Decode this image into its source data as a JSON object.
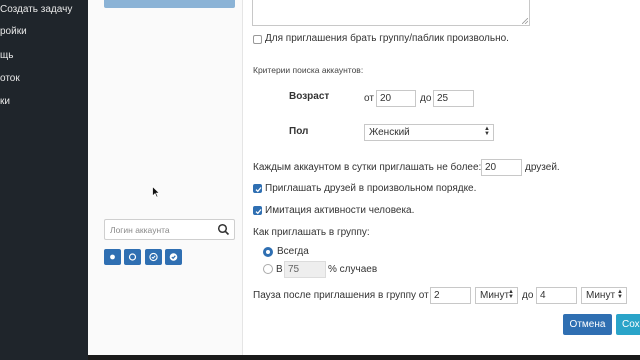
{
  "nav": {
    "items": [
      {
        "label": "Создать задачу"
      },
      {
        "label": "ройки"
      },
      {
        "label": "щь"
      },
      {
        "label": "оток"
      },
      {
        "label": "ки"
      }
    ]
  },
  "sidebar": {
    "login_placeholder": "Логин аккаунта"
  },
  "form": {
    "random_group_label": "Для приглашения брать группу/паблик произвольно.",
    "criteria_title": "Критерии поиска аккаунтов:",
    "age_label": "Возраст",
    "age_from_label": "от",
    "age_from": "20",
    "age_to_label": "до",
    "age_to": "25",
    "gender_label": "Пол",
    "gender_value": "Женский",
    "daily_label": "Каждым аккаунтом в сутки приглашать не более:",
    "daily_value": "20",
    "daily_suffix": "друзей.",
    "random_order_label": "Приглашать друзей в произвольном порядке.",
    "human_label": "Имитация активности человека.",
    "how_label": "Как приглашать в группу:",
    "always_label": "Всегда",
    "in_label": "В",
    "percent_value": "75",
    "percent_suffix": "% случаев",
    "pause_label": "Пауза после приглашения в группу от",
    "pause_from": "2",
    "unit_from": "Минут",
    "pause_to_label": "до",
    "pause_to": "4",
    "unit_to": "Минут",
    "cancel_label": "Отмена",
    "save_label": "Сох"
  },
  "colors": {
    "accent": "#2f6fb2",
    "cancel": "#2f6fb2",
    "save": "#2aa4c9",
    "nav_bg": "#1f252b"
  }
}
